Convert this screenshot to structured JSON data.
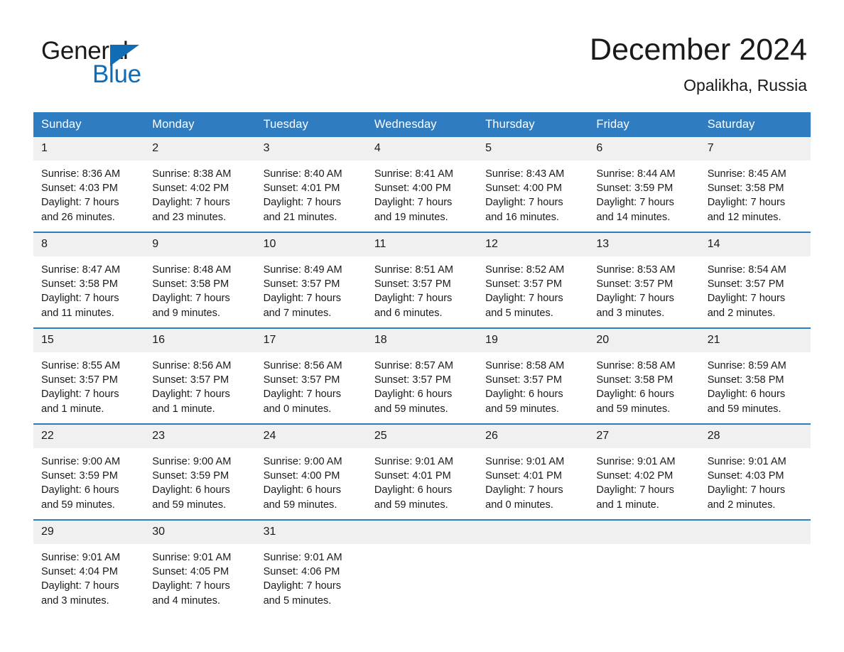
{
  "brand": {
    "name_part1": "General",
    "name_part2": "Blue",
    "accent_color": "#0f6cb5",
    "triangle_icon": "triangle-icon"
  },
  "header": {
    "month_title": "December 2024",
    "location": "Opalikha, Russia"
  },
  "calendar": {
    "header_bg": "#2f7cc0",
    "daycell_bg": "#f0f0f0",
    "weekdays": [
      "Sunday",
      "Monday",
      "Tuesday",
      "Wednesday",
      "Thursday",
      "Friday",
      "Saturday"
    ],
    "weeks": [
      [
        {
          "day": "1",
          "sunrise": "Sunrise: 8:36 AM",
          "sunset": "Sunset: 4:03 PM",
          "daylight_line1": "Daylight: 7 hours",
          "daylight_line2": "and 26 minutes."
        },
        {
          "day": "2",
          "sunrise": "Sunrise: 8:38 AM",
          "sunset": "Sunset: 4:02 PM",
          "daylight_line1": "Daylight: 7 hours",
          "daylight_line2": "and 23 minutes."
        },
        {
          "day": "3",
          "sunrise": "Sunrise: 8:40 AM",
          "sunset": "Sunset: 4:01 PM",
          "daylight_line1": "Daylight: 7 hours",
          "daylight_line2": "and 21 minutes."
        },
        {
          "day": "4",
          "sunrise": "Sunrise: 8:41 AM",
          "sunset": "Sunset: 4:00 PM",
          "daylight_line1": "Daylight: 7 hours",
          "daylight_line2": "and 19 minutes."
        },
        {
          "day": "5",
          "sunrise": "Sunrise: 8:43 AM",
          "sunset": "Sunset: 4:00 PM",
          "daylight_line1": "Daylight: 7 hours",
          "daylight_line2": "and 16 minutes."
        },
        {
          "day": "6",
          "sunrise": "Sunrise: 8:44 AM",
          "sunset": "Sunset: 3:59 PM",
          "daylight_line1": "Daylight: 7 hours",
          "daylight_line2": "and 14 minutes."
        },
        {
          "day": "7",
          "sunrise": "Sunrise: 8:45 AM",
          "sunset": "Sunset: 3:58 PM",
          "daylight_line1": "Daylight: 7 hours",
          "daylight_line2": "and 12 minutes."
        }
      ],
      [
        {
          "day": "8",
          "sunrise": "Sunrise: 8:47 AM",
          "sunset": "Sunset: 3:58 PM",
          "daylight_line1": "Daylight: 7 hours",
          "daylight_line2": "and 11 minutes."
        },
        {
          "day": "9",
          "sunrise": "Sunrise: 8:48 AM",
          "sunset": "Sunset: 3:58 PM",
          "daylight_line1": "Daylight: 7 hours",
          "daylight_line2": "and 9 minutes."
        },
        {
          "day": "10",
          "sunrise": "Sunrise: 8:49 AM",
          "sunset": "Sunset: 3:57 PM",
          "daylight_line1": "Daylight: 7 hours",
          "daylight_line2": "and 7 minutes."
        },
        {
          "day": "11",
          "sunrise": "Sunrise: 8:51 AM",
          "sunset": "Sunset: 3:57 PM",
          "daylight_line1": "Daylight: 7 hours",
          "daylight_line2": "and 6 minutes."
        },
        {
          "day": "12",
          "sunrise": "Sunrise: 8:52 AM",
          "sunset": "Sunset: 3:57 PM",
          "daylight_line1": "Daylight: 7 hours",
          "daylight_line2": "and 5 minutes."
        },
        {
          "day": "13",
          "sunrise": "Sunrise: 8:53 AM",
          "sunset": "Sunset: 3:57 PM",
          "daylight_line1": "Daylight: 7 hours",
          "daylight_line2": "and 3 minutes."
        },
        {
          "day": "14",
          "sunrise": "Sunrise: 8:54 AM",
          "sunset": "Sunset: 3:57 PM",
          "daylight_line1": "Daylight: 7 hours",
          "daylight_line2": "and 2 minutes."
        }
      ],
      [
        {
          "day": "15",
          "sunrise": "Sunrise: 8:55 AM",
          "sunset": "Sunset: 3:57 PM",
          "daylight_line1": "Daylight: 7 hours",
          "daylight_line2": "and 1 minute."
        },
        {
          "day": "16",
          "sunrise": "Sunrise: 8:56 AM",
          "sunset": "Sunset: 3:57 PM",
          "daylight_line1": "Daylight: 7 hours",
          "daylight_line2": "and 1 minute."
        },
        {
          "day": "17",
          "sunrise": "Sunrise: 8:56 AM",
          "sunset": "Sunset: 3:57 PM",
          "daylight_line1": "Daylight: 7 hours",
          "daylight_line2": "and 0 minutes."
        },
        {
          "day": "18",
          "sunrise": "Sunrise: 8:57 AM",
          "sunset": "Sunset: 3:57 PM",
          "daylight_line1": "Daylight: 6 hours",
          "daylight_line2": "and 59 minutes."
        },
        {
          "day": "19",
          "sunrise": "Sunrise: 8:58 AM",
          "sunset": "Sunset: 3:57 PM",
          "daylight_line1": "Daylight: 6 hours",
          "daylight_line2": "and 59 minutes."
        },
        {
          "day": "20",
          "sunrise": "Sunrise: 8:58 AM",
          "sunset": "Sunset: 3:58 PM",
          "daylight_line1": "Daylight: 6 hours",
          "daylight_line2": "and 59 minutes."
        },
        {
          "day": "21",
          "sunrise": "Sunrise: 8:59 AM",
          "sunset": "Sunset: 3:58 PM",
          "daylight_line1": "Daylight: 6 hours",
          "daylight_line2": "and 59 minutes."
        }
      ],
      [
        {
          "day": "22",
          "sunrise": "Sunrise: 9:00 AM",
          "sunset": "Sunset: 3:59 PM",
          "daylight_line1": "Daylight: 6 hours",
          "daylight_line2": "and 59 minutes."
        },
        {
          "day": "23",
          "sunrise": "Sunrise: 9:00 AM",
          "sunset": "Sunset: 3:59 PM",
          "daylight_line1": "Daylight: 6 hours",
          "daylight_line2": "and 59 minutes."
        },
        {
          "day": "24",
          "sunrise": "Sunrise: 9:00 AM",
          "sunset": "Sunset: 4:00 PM",
          "daylight_line1": "Daylight: 6 hours",
          "daylight_line2": "and 59 minutes."
        },
        {
          "day": "25",
          "sunrise": "Sunrise: 9:01 AM",
          "sunset": "Sunset: 4:01 PM",
          "daylight_line1": "Daylight: 6 hours",
          "daylight_line2": "and 59 minutes."
        },
        {
          "day": "26",
          "sunrise": "Sunrise: 9:01 AM",
          "sunset": "Sunset: 4:01 PM",
          "daylight_line1": "Daylight: 7 hours",
          "daylight_line2": "and 0 minutes."
        },
        {
          "day": "27",
          "sunrise": "Sunrise: 9:01 AM",
          "sunset": "Sunset: 4:02 PM",
          "daylight_line1": "Daylight: 7 hours",
          "daylight_line2": "and 1 minute."
        },
        {
          "day": "28",
          "sunrise": "Sunrise: 9:01 AM",
          "sunset": "Sunset: 4:03 PM",
          "daylight_line1": "Daylight: 7 hours",
          "daylight_line2": "and 2 minutes."
        }
      ],
      [
        {
          "day": "29",
          "sunrise": "Sunrise: 9:01 AM",
          "sunset": "Sunset: 4:04 PM",
          "daylight_line1": "Daylight: 7 hours",
          "daylight_line2": "and 3 minutes."
        },
        {
          "day": "30",
          "sunrise": "Sunrise: 9:01 AM",
          "sunset": "Sunset: 4:05 PM",
          "daylight_line1": "Daylight: 7 hours",
          "daylight_line2": "and 4 minutes."
        },
        {
          "day": "31",
          "sunrise": "Sunrise: 9:01 AM",
          "sunset": "Sunset: 4:06 PM",
          "daylight_line1": "Daylight: 7 hours",
          "daylight_line2": "and 5 minutes."
        },
        {
          "day": "",
          "sunrise": "",
          "sunset": "",
          "daylight_line1": "",
          "daylight_line2": "",
          "empty": true
        },
        {
          "day": "",
          "sunrise": "",
          "sunset": "",
          "daylight_line1": "",
          "daylight_line2": "",
          "empty": true
        },
        {
          "day": "",
          "sunrise": "",
          "sunset": "",
          "daylight_line1": "",
          "daylight_line2": "",
          "empty": true
        },
        {
          "day": "",
          "sunrise": "",
          "sunset": "",
          "daylight_line1": "",
          "daylight_line2": "",
          "empty": true
        }
      ]
    ]
  }
}
